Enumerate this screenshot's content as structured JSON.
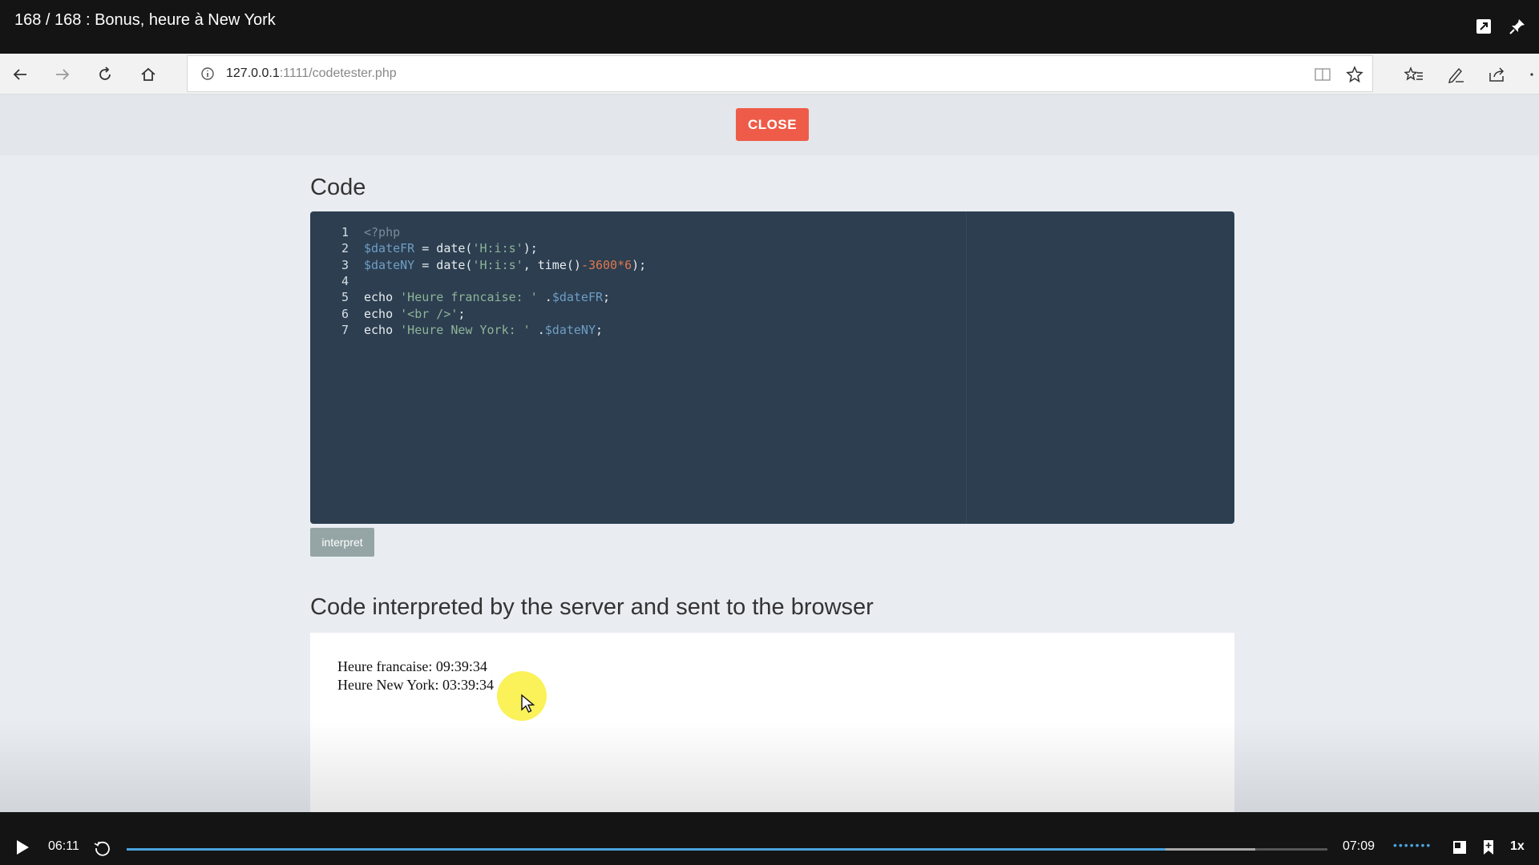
{
  "video": {
    "title": "168 / 168 : Bonus, heure à New York",
    "current_time": "06:11",
    "duration": "07:09",
    "speed": "1x",
    "progress_fraction": 0.865,
    "buffered_fraction": 0.94,
    "volume_dots": "•••••••",
    "replay_label": "10"
  },
  "browser": {
    "url_host": "127.0.0.1",
    "url_rest": ":1111/codetester.php"
  },
  "page": {
    "close_label": "CLOSE",
    "code_heading": "Code",
    "interpret_label": "interpret",
    "output_heading": "Code interpreted by the server and sent to the browser",
    "output_lines": [
      "Heure francaise: 09:39:34",
      "Heure New York: 03:39:34"
    ]
  },
  "code": {
    "line_numbers": [
      "1",
      "2",
      "3",
      "4",
      "5",
      "6",
      "7"
    ],
    "lines": [
      [
        {
          "t": "<?php",
          "c": "dim"
        }
      ],
      [
        {
          "t": "$dateFR",
          "c": "var"
        },
        {
          "t": " = date(",
          "c": "kw"
        },
        {
          "t": "'H:i:s'",
          "c": "str"
        },
        {
          "t": ");",
          "c": "kw"
        }
      ],
      [
        {
          "t": "$dateNY",
          "c": "var"
        },
        {
          "t": " = date(",
          "c": "kw"
        },
        {
          "t": "'H:i:s'",
          "c": "str"
        },
        {
          "t": ", time()",
          "c": "kw"
        },
        {
          "t": "-3600*6",
          "c": "num"
        },
        {
          "t": ");",
          "c": "kw"
        }
      ],
      [],
      [
        {
          "t": "echo ",
          "c": "kw"
        },
        {
          "t": "'Heure francaise: '",
          "c": "str"
        },
        {
          "t": " .",
          "c": "kw"
        },
        {
          "t": "$dateFR",
          "c": "var"
        },
        {
          "t": ";",
          "c": "kw"
        }
      ],
      [
        {
          "t": "echo ",
          "c": "kw"
        },
        {
          "t": "'<br />'",
          "c": "str"
        },
        {
          "t": ";",
          "c": "kw"
        }
      ],
      [
        {
          "t": "echo ",
          "c": "kw"
        },
        {
          "t": "'Heure New York: '",
          "c": "str"
        },
        {
          "t": " .",
          "c": "kw"
        },
        {
          "t": "$dateNY",
          "c": "var"
        },
        {
          "t": ";",
          "c": "kw"
        }
      ]
    ]
  },
  "colors": {
    "close_button": "#ee5c49",
    "editor_background": "#2c3e50",
    "interpret_button": "#95a5a6",
    "progress_accent": "#4aa3df"
  },
  "icons": {
    "title_bar": [
      "popout-icon",
      "pin-icon"
    ],
    "browser_nav": [
      "back-arrow-icon",
      "forward-arrow-icon",
      "refresh-icon",
      "home-icon"
    ],
    "address_bar": [
      "info-icon",
      "reading-view-icon",
      "favorite-star-icon"
    ],
    "browser_right": [
      "favorites-hub-icon",
      "pen-icon",
      "share-icon",
      "more-icon"
    ],
    "player": [
      "play-icon",
      "replay-10-icon",
      "fullscreen-icon",
      "bookmark-icon"
    ]
  }
}
